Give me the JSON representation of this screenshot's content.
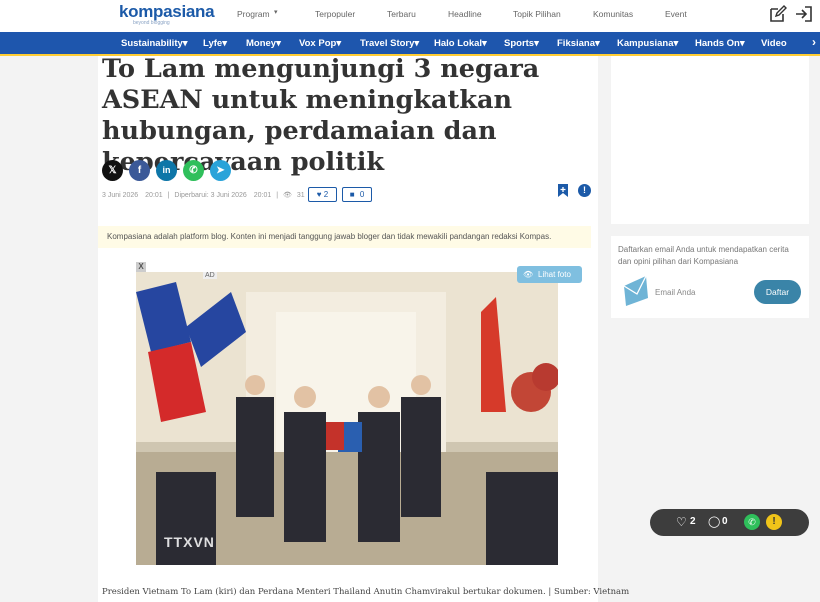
{
  "header": {
    "logo": "kompasiana",
    "logo_tagline": "beyond blogging",
    "nav": [
      "Program",
      "Terpopuler",
      "Terbaru",
      "Headline",
      "Topik Pilihan",
      "Komunitas",
      "Event"
    ]
  },
  "category_nav": [
    "Sustainability",
    "Lyfe",
    "Money",
    "Vox Pop",
    "Travel Story",
    "Halo Lokal",
    "Sports",
    "Fiksiana",
    "Kampusiana",
    "Hands On",
    "Video"
  ],
  "article": {
    "title": "To Lam mengunjungi 3 negara ASEAN untuk meningkatkan hubungan, perdamaian dan kepercayaan politik",
    "share_icons": [
      "x-icon",
      "facebook-icon",
      "linkedin-icon",
      "whatsapp-icon",
      "telegram-icon"
    ],
    "date": "3 Juni 2026",
    "time": "20:01",
    "updated_label": "Diperbarui: 3 Juni 2026",
    "updated_time": "20:01",
    "views": "31",
    "likes": "2",
    "comments": "0",
    "notice": "Kompasiana adalah platform blog. Konten ini menjadi tanggung jawab bloger dan tidak mewakili pandangan redaksi Kompas.",
    "ad_label": "AD",
    "close_label": "X",
    "lihat_foto": "Lihat foto",
    "photo_watermark": "TTXVN",
    "caption": "Presiden Vietnam To Lam (kiri) dan Perdana Menteri Thailand Anutin Chamvirakul bertukar dokumen. | Sumber: Vietnam"
  },
  "sidebar": {
    "subscribe_text": "Daftarkan email Anda untuk mendapatkan cerita dan opini pilihan dari Kompasiana",
    "email_placeholder": "Email Anda",
    "subscribe_button": "Daftar"
  },
  "floating_bar": {
    "likes": "2",
    "comments": "0"
  },
  "colors": {
    "brand_blue": "#1e56ad",
    "accent_yellow": "#ffcd34",
    "button_teal": "#3a84a8"
  }
}
